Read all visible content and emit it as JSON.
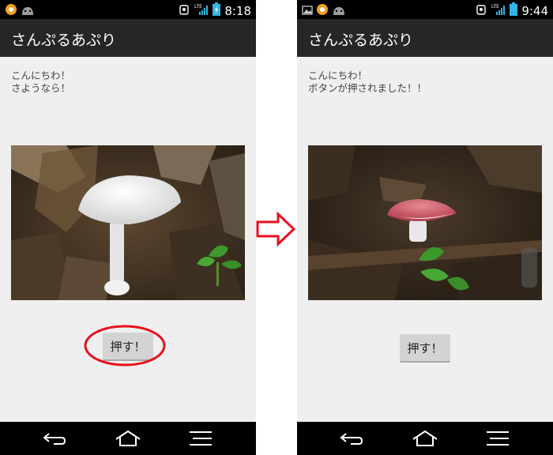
{
  "screens": [
    {
      "id": "before",
      "status_clock": "8:18",
      "status_icons": [
        "lock-alert-icon",
        "android-icon",
        "lte-icon",
        "signal-icon",
        "battery-charging-icon"
      ],
      "app_title": "さんぷるあぷり",
      "text_lines": [
        "こんにちわ！",
        "さようなら！"
      ],
      "photo": "white-mushroom",
      "button_label": "押す！",
      "button_highlighted": true
    },
    {
      "id": "after",
      "status_clock": "9:44",
      "status_icons": [
        "image-icon",
        "lock-alert-icon",
        "android-icon",
        "lte-icon",
        "signal-icon",
        "battery-icon"
      ],
      "app_title": "さんぷるあぷり",
      "text_lines": [
        "こんにちわ！",
        "ボタンが押されました！！"
      ],
      "photo": "red-mushroom",
      "button_label": "押す！",
      "button_highlighted": false
    }
  ],
  "nav_icons": [
    "back-icon",
    "home-icon",
    "menu-icon"
  ],
  "transition_icon": "right-arrow-icon",
  "colors": {
    "highlight": "#e8101e",
    "actionbar": "#262626",
    "background": "#efefef",
    "button": "#d3d3d3"
  }
}
